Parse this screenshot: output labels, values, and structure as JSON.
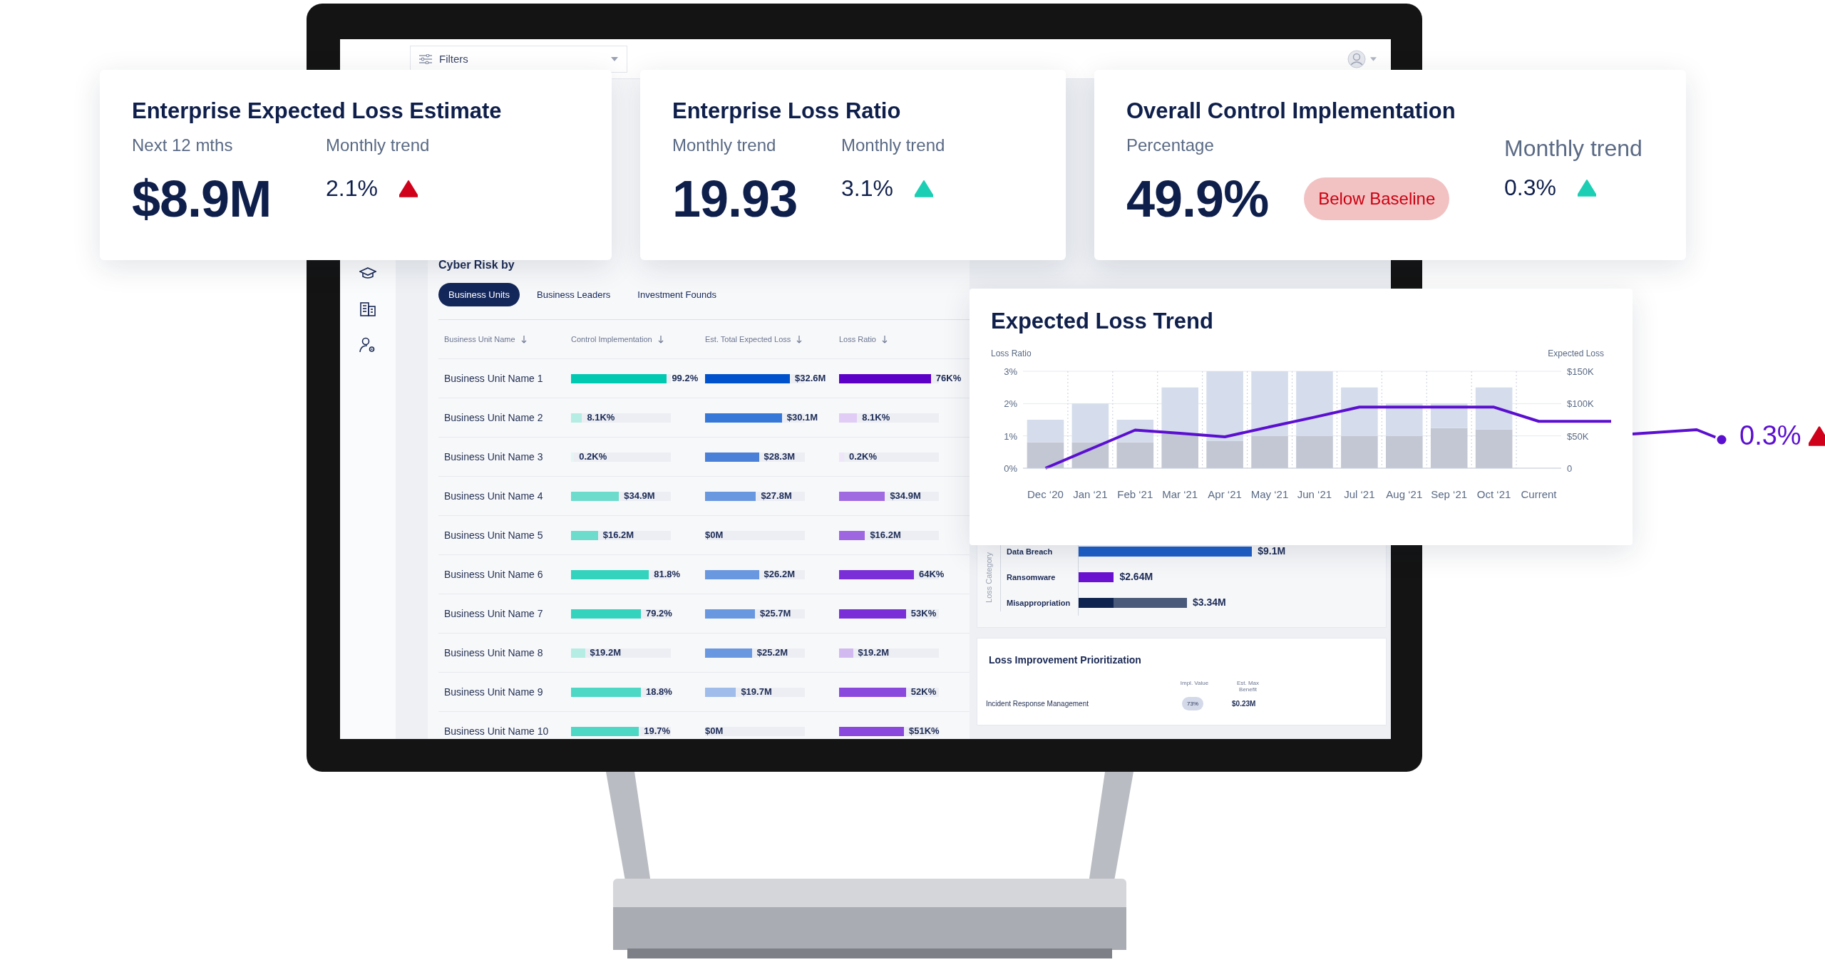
{
  "dashboard": {
    "filters": {
      "label": "Filters"
    },
    "cyber_risk": {
      "title": "Cyber Risk by",
      "tabs": [
        {
          "label": "Business Units",
          "selected": true
        },
        {
          "label": "Business Leaders",
          "selected": false
        },
        {
          "label": "Investment Founds",
          "selected": false
        }
      ],
      "table": {
        "columns": [
          "Business Unit Name",
          "Control Implementation",
          "Est. Total Expected Loss",
          "Loss Ratio"
        ],
        "rows": [
          {
            "name": "Business Unit Name 1",
            "control": {
              "value": "99.2%",
              "level": 0.96,
              "color": "#00c9b1"
            },
            "loss": {
              "value": "$32.6M",
              "level": 0.85,
              "color": "#0052cc"
            },
            "ratio": {
              "value": "76K%",
              "level": 0.92,
              "color": "#5c00c8"
            }
          },
          {
            "name": "Business Unit Name 2",
            "control": {
              "value": "8.1K%",
              "level": 0.11,
              "color": "#b5ece4"
            },
            "loss": {
              "value": "$30.1M",
              "level": 0.77,
              "color": "#3578d8"
            },
            "ratio": {
              "value": "8.1K%",
              "level": 0.18,
              "color": "#e0ccf5"
            }
          },
          {
            "name": "Business Unit Name 3",
            "control": {
              "value": "0.2K%",
              "level": 0.03,
              "color": "#e3f6f3"
            },
            "loss": {
              "value": "$28.3M",
              "level": 0.54,
              "color": "#4a80d8"
            },
            "ratio": {
              "value": "0.2K%",
              "level": 0.05,
              "color": "#efe6fa"
            }
          },
          {
            "name": "Business Unit Name 4",
            "control": {
              "value": "$34.9M",
              "level": 0.48,
              "color": "#6ddccd"
            },
            "loss": {
              "value": "$27.8M",
              "level": 0.51,
              "color": "#6a98e0"
            },
            "ratio": {
              "value": "$34.9M",
              "level": 0.46,
              "color": "#a06ae0"
            }
          },
          {
            "name": "Business Unit Name 5",
            "control": {
              "value": "$16.2M",
              "level": 0.27,
              "color": "#6ddccd"
            },
            "loss": {
              "value": "$0M"
            },
            "ratio": {
              "value": "$16.2M",
              "level": 0.26,
              "color": "#9e66e0"
            }
          },
          {
            "name": "Business Unit Name 6",
            "control": {
              "value": "81.8%",
              "level": 0.78,
              "color": "#33d3be"
            },
            "loss": {
              "value": "$26.2M",
              "level": 0.54,
              "color": "#6a98e0"
            },
            "ratio": {
              "value": "64K%",
              "level": 0.75,
              "color": "#7a2ed8"
            }
          },
          {
            "name": "Business Unit Name 7",
            "control": {
              "value": "79.2%",
              "level": 0.7,
              "color": "#33d3be"
            },
            "loss": {
              "value": "$25.7M",
              "level": 0.5,
              "color": "#6a98e0"
            },
            "ratio": {
              "value": "53K%",
              "level": 0.67,
              "color": "#7a2ed8"
            }
          },
          {
            "name": "Business Unit Name 8",
            "control": {
              "value": "$19.2M",
              "level": 0.14,
              "color": "#b5ece4"
            },
            "loss": {
              "value": "$25.2M",
              "level": 0.47,
              "color": "#6a98e0"
            },
            "ratio": {
              "value": "$19.2M",
              "level": 0.14,
              "color": "#d2baf0"
            }
          },
          {
            "name": "Business Unit Name 9",
            "control": {
              "value": "18.8%",
              "level": 0.7,
              "color": "#4dd8c5"
            },
            "loss": {
              "value": "$19.7M",
              "level": 0.31,
              "color": "#a0bcea"
            },
            "ratio": {
              "value": "52K%",
              "level": 0.67,
              "color": "#8a48dc"
            }
          },
          {
            "name": "Business Unit Name 10",
            "control": {
              "value": "19.7%",
              "level": 0.68,
              "color": "#4dd8c5"
            },
            "loss": {
              "value": "$0M"
            },
            "ratio": {
              "value": "$51K%",
              "level": 0.65,
              "color": "#8a48dc"
            }
          }
        ]
      }
    },
    "loss_category": {
      "axis_label": "Loss Category",
      "rows": [
        {
          "label": "Data Breach",
          "value": "$9.1M",
          "segments": [
            {
              "level": 0.64,
              "color": "#1f5fc8"
            }
          ]
        },
        {
          "label": "Ransomware",
          "value": "$2.64M",
          "segments": [
            {
              "level": 0.13,
              "color": "#6a12d0"
            }
          ]
        },
        {
          "label": "Misappropriation",
          "value": "$3.34M",
          "segments": [
            {
              "level": 0.13,
              "color": "#0f2350"
            },
            {
              "level": 0.27,
              "color": "#4a5a7a"
            }
          ]
        }
      ]
    },
    "loss_improvement": {
      "title": "Loss Improvement Prioritization",
      "columns": [
        "Impl. Value",
        "Est. Max Benefit"
      ],
      "rows": [
        {
          "name": "Incident Response Management",
          "impl_value": "73%",
          "benefit": "$0.23M"
        }
      ]
    }
  },
  "cards": [
    {
      "title": "Enterprise Expected Loss Estimate",
      "value_label": "Next 12 mths",
      "trend_label": "Monthly trend",
      "value": "$8.9M",
      "trend": {
        "value": "2.1%",
        "color": "#d0021b"
      }
    },
    {
      "title": "Enterprise Loss Ratio",
      "value_label": "Monthly trend",
      "trend_label": "Monthly trend",
      "value": "19.93",
      "trend": {
        "value": "3.1%",
        "color": "#1ccfb4"
      }
    },
    {
      "title": "Overall Control Implementation",
      "value_label": "Percentage",
      "trend_label": "Monthly trend",
      "value": "49.9%",
      "badge": "Below Baseline",
      "trend": {
        "value": "0.3%",
        "color": "#1ccfb4"
      }
    }
  ],
  "trend_chart": {
    "title": "Expected Loss Trend",
    "chart_data": {
      "type": "bar",
      "ylabel": "Loss Ratio",
      "y2label": "Expected Loss",
      "categories": [
        "Dec ‘20",
        "Jan ‘21",
        "Feb ‘21",
        "Mar ‘21",
        "Apr ‘21",
        "May ‘21",
        "Jun ‘21",
        "Jul ‘21",
        "Aug ‘21",
        "Sep ‘21",
        "Oct ‘21",
        "Current"
      ],
      "series": [
        {
          "type": "bar",
          "axis": "y2",
          "color": "#c2c7d3",
          "values": [
            40,
            40,
            40,
            53,
            42,
            50,
            50,
            50,
            50,
            62,
            60,
            null
          ]
        },
        {
          "type": "bar",
          "axis": "y2",
          "color": "#d5ddec",
          "values": [
            35,
            60,
            35,
            72,
            108,
            100,
            100,
            75,
            50,
            38,
            65,
            null
          ]
        },
        {
          "type": "line",
          "color": "#5b0fd0",
          "values": [
            0,
            0.59,
            1.18,
            1.08,
            0.97,
            1.28,
            1.58,
            1.89,
            1.89,
            1.89,
            1.89,
            1.45
          ]
        }
      ],
      "stacked": true,
      "ylim": [
        0,
        3
      ],
      "yticks": [
        {
          "value": 0,
          "label": "0%"
        },
        {
          "value": 1,
          "label": "1%"
        },
        {
          "value": 2,
          "label": "2%"
        },
        {
          "value": 3,
          "label": "3%"
        }
      ],
      "y2lim": [
        0,
        150
      ],
      "y2ticks": [
        {
          "value": 0,
          "label": "0"
        },
        {
          "value": 50,
          "label": "$50K"
        },
        {
          "value": 100,
          "label": "$100K"
        },
        {
          "value": 150,
          "label": "$150K"
        }
      ]
    },
    "callout": {
      "value": "0.3%",
      "color": "#d0021b"
    }
  }
}
